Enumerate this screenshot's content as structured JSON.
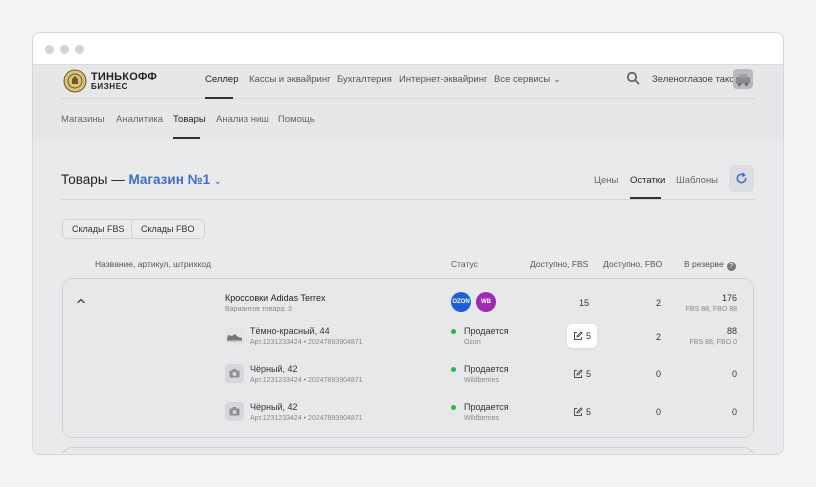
{
  "brand": {
    "name_line1": "ТИНЬКОФФ",
    "name_line2": "БИЗНЕС"
  },
  "top_nav": {
    "items": [
      "Селлер",
      "Кассы и эквайринг",
      "Бухгалтерия",
      "Интернет-эквайринг",
      "Все сервисы"
    ],
    "active": "Селлер",
    "user": "Зеленоглазое такси"
  },
  "sub_nav": {
    "items": [
      "Магазины",
      "Аналитика",
      "Товары",
      "Анализ ниш",
      "Помощь"
    ],
    "active": "Товары"
  },
  "page": {
    "title_prefix": "Товары —",
    "store": "Магазин №1",
    "tabs": [
      "Цены",
      "Остатки",
      "Шаблоны"
    ],
    "active_tab": "Остатки"
  },
  "filters": [
    "Склады FBS",
    "Склады FBO"
  ],
  "table": {
    "headers": {
      "name": "Название, артикул, штрихкод",
      "status": "Статус",
      "fbs": "Доступно, FBS",
      "fbo": "Доступно, FBO",
      "reserve": "В резерве"
    },
    "product": {
      "name": "Кроссовки Adidas Terrex",
      "variants": "Вариантов товара: 3",
      "marketplaces": [
        "OZON",
        "WB"
      ],
      "fbs": "15",
      "fbo": "2",
      "reserve": "176",
      "reserve_detail": "FBS 88, FBO 88"
    },
    "variants": [
      {
        "name": "Тёмно-красный, 44",
        "article": "Арт.1231233424 • 20247893904871",
        "status": "Продается",
        "market": "Ozon",
        "fbs": "5",
        "fbo": "2",
        "reserve": "88",
        "reserve_detail": "FBS 88, FBO 0"
      },
      {
        "name": "Чёрный, 42",
        "article": "Арт.1231233424 • 20247893904871",
        "status": "Продается",
        "market": "Wildberries",
        "fbs": "5",
        "fbo": "0",
        "reserve": "0",
        "reserve_detail": ""
      },
      {
        "name": "Чёрный, 42",
        "article": "Арт.1231233424 • 20247893904871",
        "status": "Продается",
        "market": "Wildberries",
        "fbs": "5",
        "fbo": "0",
        "reserve": "0",
        "reserve_detail": ""
      }
    ]
  },
  "colors": {
    "accent": "#3f6ec2",
    "status_ok": "#2db34a",
    "ozon": "#1f5fd6",
    "wb": "#9b2db5"
  }
}
